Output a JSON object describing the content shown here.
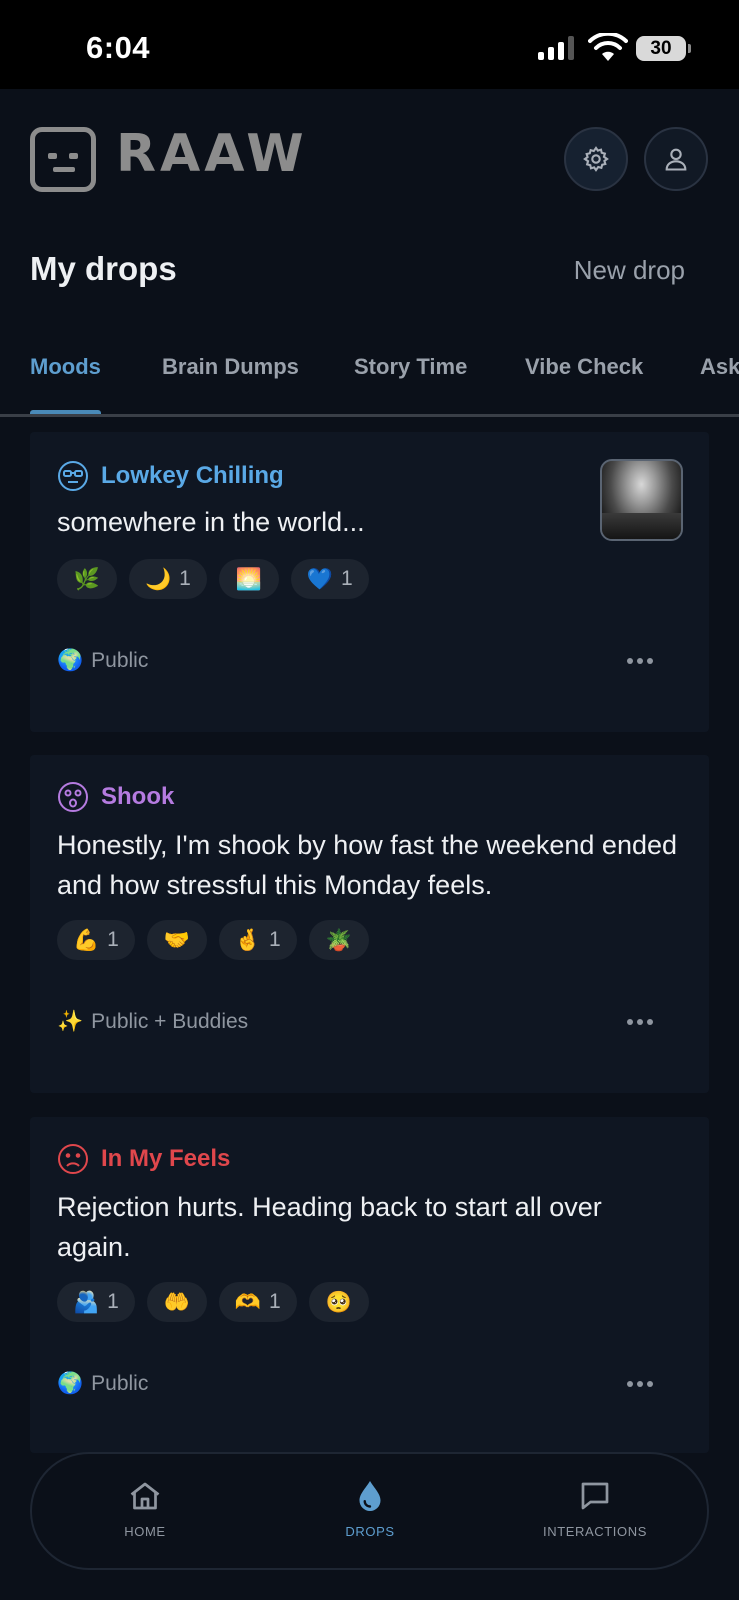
{
  "status_bar": {
    "time": "6:04",
    "battery": "30"
  },
  "header": {
    "logo_text": "RAAW",
    "logo_icon": "robot-face-icon",
    "settings_icon": "gear-icon",
    "profile_icon": "person-icon"
  },
  "page": {
    "title": "My drops",
    "new_drop_label": "New drop"
  },
  "tabs": [
    {
      "label": "Moods",
      "active": true
    },
    {
      "label": "Brain Dumps",
      "active": false
    },
    {
      "label": "Story Time",
      "active": false
    },
    {
      "label": "Vibe Check",
      "active": false
    },
    {
      "label": "Ask",
      "active": false
    }
  ],
  "drops": [
    {
      "mood": "Lowkey Chilling",
      "mood_color": "#5aa9e6",
      "mood_icon": "sunglasses-face-icon",
      "text": "somewhere in the world...",
      "has_photo": true,
      "reactions": [
        {
          "emoji": "🌿",
          "count": ""
        },
        {
          "emoji": "🌙",
          "count": "1"
        },
        {
          "emoji": "🌅",
          "count": ""
        },
        {
          "emoji": "💙",
          "count": "1"
        }
      ],
      "visibility": {
        "emoji": "🌍",
        "label": "Public"
      }
    },
    {
      "mood": "Shook",
      "mood_color": "#b57be0",
      "mood_icon": "shocked-face-icon",
      "text": "Honestly, I'm shook by how fast the weekend ended and how stressful this Monday feels.",
      "has_photo": false,
      "reactions": [
        {
          "emoji": "💪",
          "count": "1"
        },
        {
          "emoji": "🤝",
          "count": ""
        },
        {
          "emoji": "🤞",
          "count": "1"
        },
        {
          "emoji": "🪴",
          "count": ""
        }
      ],
      "visibility": {
        "emoji": "✨",
        "label": "Public + Buddies"
      }
    },
    {
      "mood": "In My Feels",
      "mood_color": "#e0474c",
      "mood_icon": "sad-face-icon",
      "text": "Rejection hurts. Heading back to start all over again.",
      "has_photo": false,
      "reactions": [
        {
          "emoji": "🫂",
          "count": "1"
        },
        {
          "emoji": "🤲",
          "count": ""
        },
        {
          "emoji": "🫶",
          "count": "1"
        },
        {
          "emoji": "🥺",
          "count": ""
        }
      ],
      "visibility": {
        "emoji": "🌍",
        "label": "Public"
      }
    }
  ],
  "bottom_nav": [
    {
      "label": "HOME",
      "icon": "home-icon",
      "active": false
    },
    {
      "label": "DROPS",
      "icon": "drop-icon",
      "active": true
    },
    {
      "label": "INTERACTIONS",
      "icon": "chat-bubble-icon",
      "active": false
    }
  ],
  "colors": {
    "accent": "#5e9ecf",
    "background": "#0b1019",
    "card": "#0f1622"
  }
}
